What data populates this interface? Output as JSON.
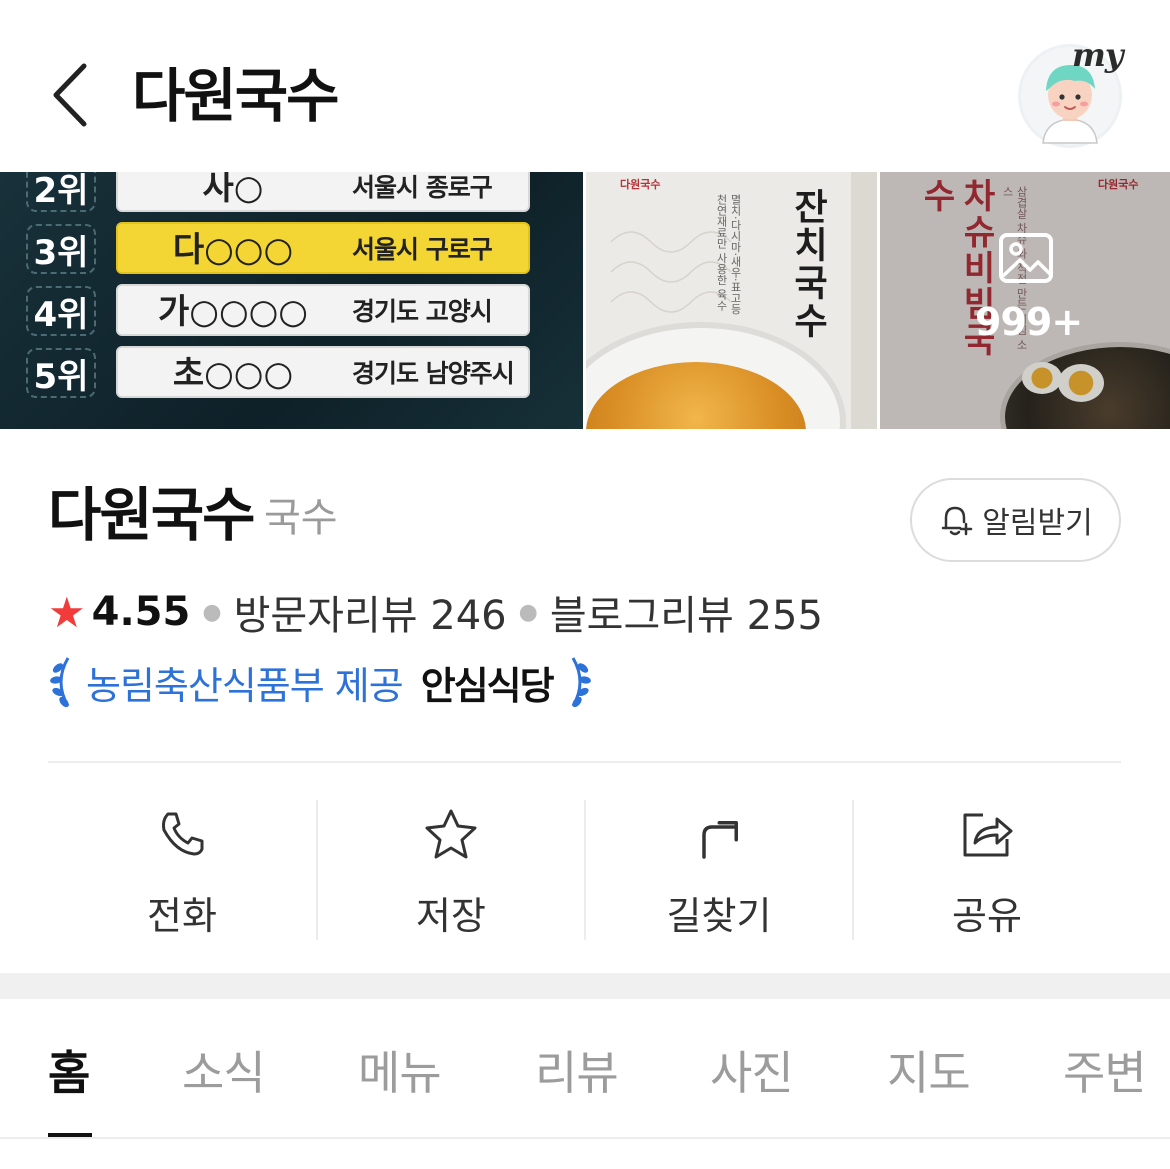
{
  "header": {
    "title": "다원국수",
    "back_icon": "chevron-left-icon",
    "profile_label": "my"
  },
  "photos": {
    "ranking": [
      {
        "rank": "2위",
        "name": "사○",
        "location": "서울시 종로구",
        "highlight": false
      },
      {
        "rank": "3위",
        "name": "다○○○",
        "location": "서울시 구로구",
        "highlight": true
      },
      {
        "rank": "4위",
        "name": "가○○○○",
        "location": "경기도 고양시",
        "highlight": false
      },
      {
        "rank": "5위",
        "name": "초○○○",
        "location": "경기도 남양주시",
        "highlight": false
      }
    ],
    "poster_1": {
      "logo": "다원국수",
      "title": "잔치국수",
      "desc": "멸치·다시마·새우·표고등 천연재료만 사용한 육수"
    },
    "poster_2": {
      "logo": "다원국수",
      "title": "차슈비빔국수",
      "desc": "삼겹살 차슈 와 직접 만든 비빔 소스"
    },
    "more_count": "999+"
  },
  "place": {
    "name": "다원국수",
    "category": "국수",
    "notify_label": "알림받기",
    "rating": "4.55",
    "visitor_reviews_label": "방문자리뷰",
    "visitor_reviews": "246",
    "blog_reviews_label": "블로그리뷰",
    "blog_reviews": "255",
    "safe_provider": "농림축산식품부 제공",
    "safe_label": "안심식당"
  },
  "actions": [
    {
      "label": "전화",
      "icon": "phone-icon"
    },
    {
      "label": "저장",
      "icon": "star-icon"
    },
    {
      "label": "길찾기",
      "icon": "directions-icon"
    },
    {
      "label": "공유",
      "icon": "share-icon"
    }
  ],
  "tabs": [
    "홈",
    "소식",
    "메뉴",
    "리뷰",
    "사진",
    "지도",
    "주변"
  ],
  "active_tab": "홈",
  "colors": {
    "accent_blue": "#2d72d8",
    "star_red": "#f23b3b",
    "highlight_yellow": "#f3d633"
  }
}
